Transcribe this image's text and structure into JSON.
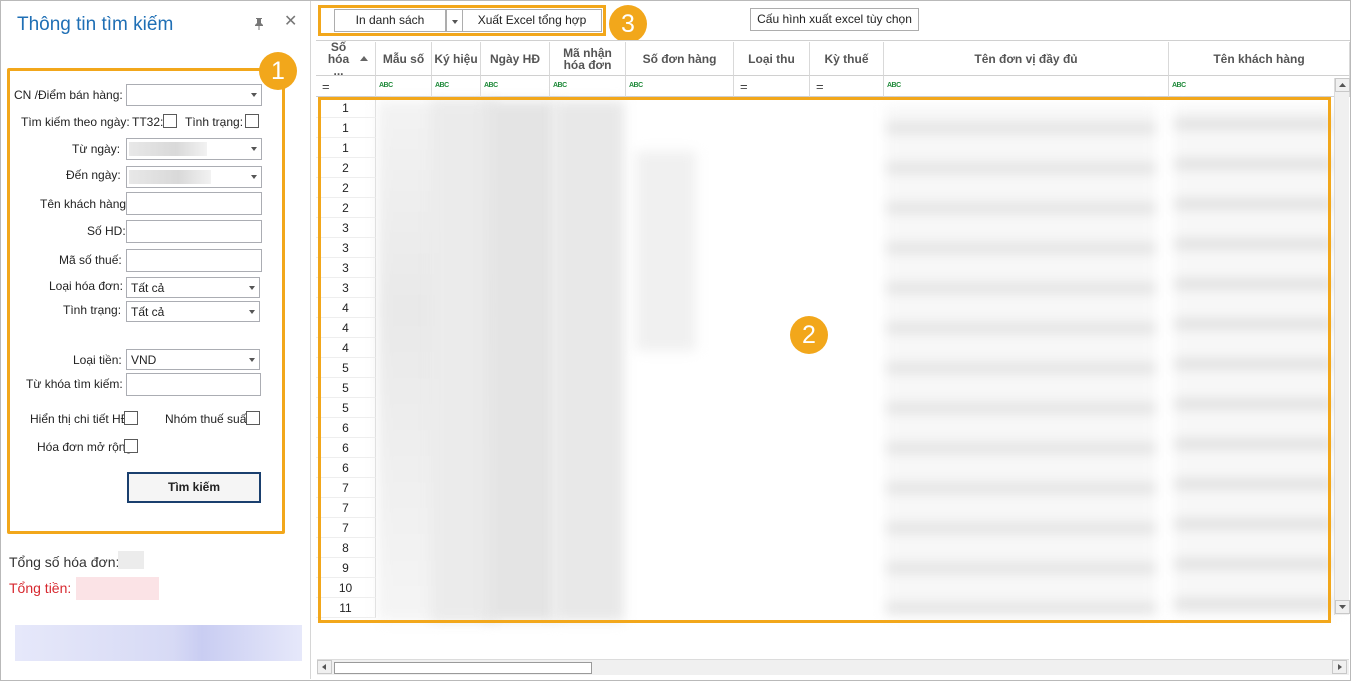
{
  "panel": {
    "title": "Thông tin tìm kiếm",
    "pin_glyph": "📌",
    "close_glyph": "✕"
  },
  "form": {
    "branch_label": "CN /Điểm bán hàng:",
    "search_by_date_label": "Tìm kiếm theo ngày:",
    "tt32_label": "TT32:",
    "status_check_label": "Tình trạng:",
    "from_date_label": "Từ ngày:",
    "to_date_label": "Đến ngày:",
    "customer_name_label": "Tên khách hàng:",
    "invoice_no_label": "Số HD:",
    "tax_code_label": "Mã số thuế:",
    "invoice_type_label": "Loại hóa đơn:",
    "invoice_type_value": "Tất cả",
    "status_label": "Tình trạng:",
    "status_value": "Tất cả",
    "currency_label": "Loại tiền:",
    "currency_value": "VND",
    "keyword_label": "Từ khóa tìm kiếm:",
    "show_detail_label": "Hiển thị chi tiết HĐ",
    "tax_group_label": "Nhóm thuế suất",
    "extended_invoice_label": "Hóa đơn mở rộng",
    "search_button": "Tìm kiếm"
  },
  "summary": {
    "total_invoices_label": "Tổng số hóa đơn:",
    "total_amount_label": "Tổng tiền:"
  },
  "toolbar": {
    "print_list": "In danh sách",
    "export_excel": "Xuất Excel tổng hợp",
    "config_export": "Cấu hình xuất excel tùy chọn"
  },
  "badges": [
    "1",
    "2",
    "3"
  ],
  "grid": {
    "columns": [
      {
        "label": "Số hóa ...",
        "filter": "eq"
      },
      {
        "label": "Mẫu số",
        "filter": "abc"
      },
      {
        "label": "Ký hiệu",
        "filter": "abc"
      },
      {
        "label": "Ngày HĐ",
        "filter": "abc"
      },
      {
        "label": "Mã nhận hóa đơn",
        "filter": "abc"
      },
      {
        "label": "Số đơn hàng",
        "filter": "abc"
      },
      {
        "label": "Loại thu",
        "filter": "eq"
      },
      {
        "label": "Kỳ thuế",
        "filter": "eq"
      },
      {
        "label": "Tên đơn vị đầy đủ",
        "filter": "abc"
      },
      {
        "label": "Tên khách hàng",
        "filter": "abc"
      }
    ],
    "row_numbers": [
      "1",
      "1",
      "1",
      "2",
      "2",
      "2",
      "3",
      "3",
      "3",
      "3",
      "4",
      "4",
      "4",
      "5",
      "5",
      "5",
      "6",
      "6",
      "6",
      "7",
      "7",
      "7",
      "8",
      "9",
      "10",
      "11"
    ],
    "abc_glyph": "ABC",
    "eq_glyph": "="
  }
}
